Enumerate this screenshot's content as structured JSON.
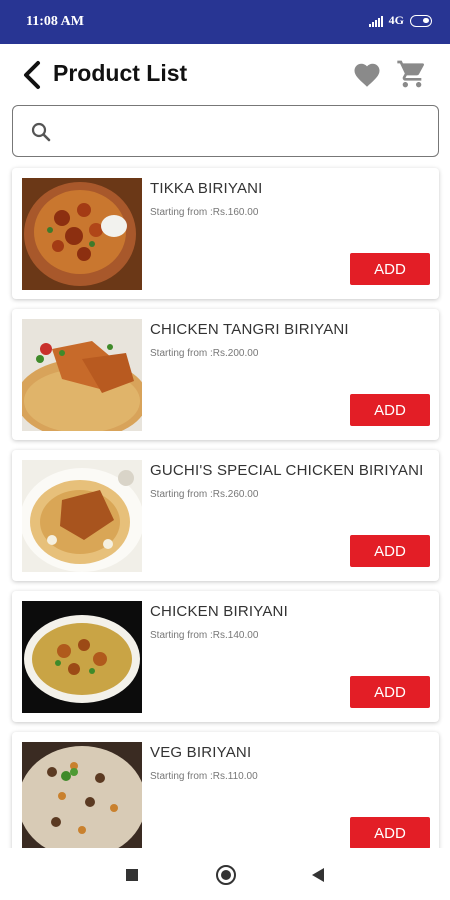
{
  "status_bar": {
    "time": "11:08 AM",
    "network": "4G"
  },
  "header": {
    "title": "Product List"
  },
  "search": {
    "placeholder": ""
  },
  "colors": {
    "status_bar": "#283593",
    "add_button": "#e31e26",
    "icon_grey": "#8a8a8a"
  },
  "icons": {
    "back": "chevron-left-icon",
    "favorite": "heart-icon",
    "cart": "cart-icon",
    "search": "search-icon"
  },
  "products": [
    {
      "name": "TIKKA BIRIYANI",
      "price": "Starting from :Rs.160.00",
      "add_label": "ADD"
    },
    {
      "name": "CHICKEN TANGRI BIRIYANI",
      "price": "Starting from :Rs.200.00",
      "add_label": "ADD"
    },
    {
      "name": "GUCHI'S SPECIAL CHICKEN BIRIYANI",
      "price": "Starting from :Rs.260.00",
      "add_label": "ADD"
    },
    {
      "name": "CHICKEN BIRIYANI",
      "price": "Starting from :Rs.140.00",
      "add_label": "ADD"
    },
    {
      "name": "VEG BIRIYANI",
      "price": "Starting from :Rs.110.00",
      "add_label": "ADD"
    }
  ]
}
